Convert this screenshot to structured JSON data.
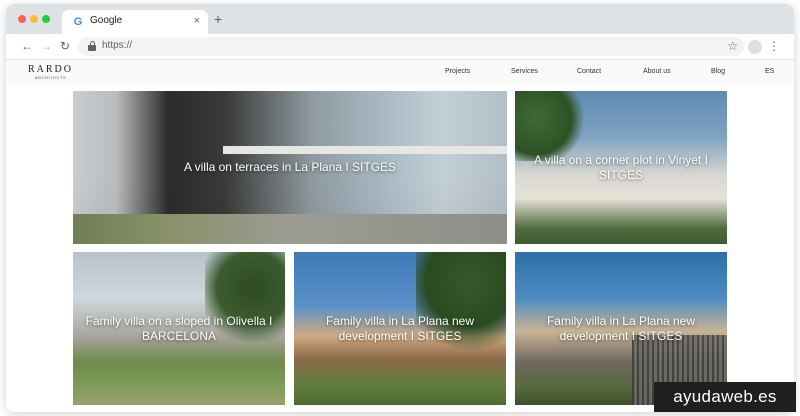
{
  "browser": {
    "tab_title": "Google",
    "tab_favicon_letter": "G",
    "close_glyph": "×",
    "new_tab_glyph": "+",
    "back_glyph": "←",
    "forward_glyph": "→",
    "reload_glyph": "↻",
    "address_url": "https://",
    "star_glyph": "☆",
    "menu_glyph": "⋮",
    "icons": {
      "favicon": "google-icon",
      "lock": "lock-icon",
      "star": "star-icon",
      "menu": "kebab-menu-icon"
    }
  },
  "site": {
    "logo_main": "RARDO",
    "logo_sub": "ARCHITECTS",
    "nav": {
      "projects": "Projects",
      "services": "Services",
      "contact": "Contact",
      "about": "About us",
      "blog": "Blog",
      "lang": "ES"
    }
  },
  "projects": [
    {
      "title": "A villa on terraces in La Plana I SITGES"
    },
    {
      "title": "A villa on a corner plot in Vinyet I SITGES"
    },
    {
      "title": "Family villa on a sloped in Olivella I BARCELONA"
    },
    {
      "title": "Family villa in La Plana new development I SITGES"
    },
    {
      "title": "Family villa in La Plana new development I SITGES"
    }
  ],
  "watermark": "ayudaweb.es",
  "colors": {
    "tabstrip": "#dee1e6",
    "omnibox": "#f1f3f4",
    "watermark_bg": "#1f1f1f"
  }
}
